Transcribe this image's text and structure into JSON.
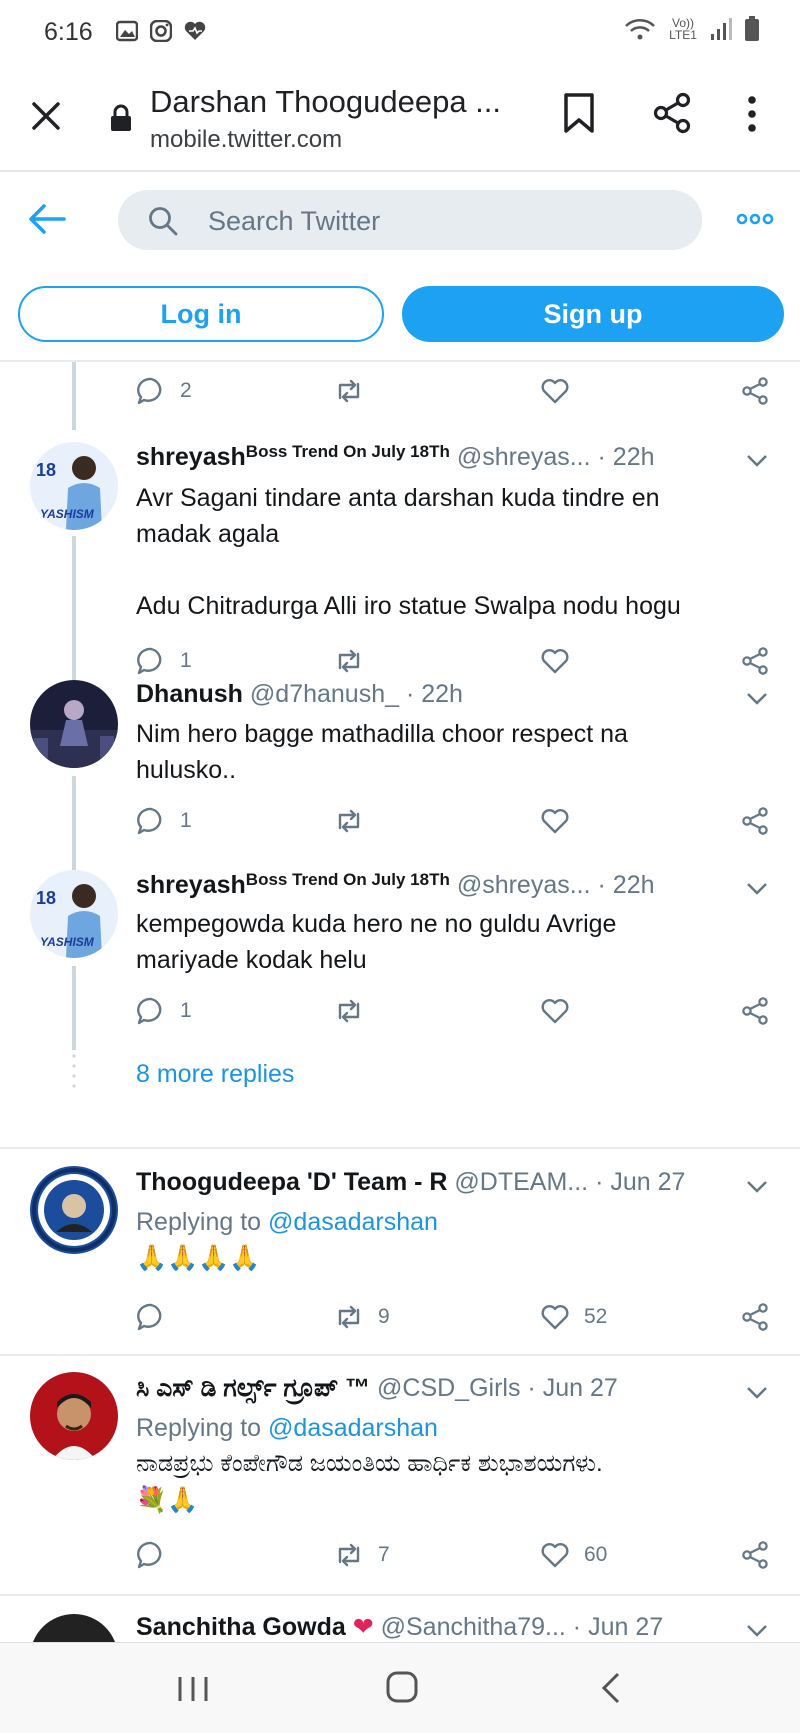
{
  "status_bar": {
    "time": "6:16",
    "network": "Vo)) LTE1"
  },
  "browser": {
    "title": "Darshan Thoogudeepa ...",
    "url": "mobile.twitter.com"
  },
  "twitter": {
    "search_placeholder": "Search Twitter",
    "login_label": "Log in",
    "signup_label": "Sign up",
    "accent": "#1da1f2"
  },
  "tweets": [
    {
      "replies": "2",
      "retweets": "",
      "likes": ""
    },
    {
      "name": "shreyash",
      "badge": "Boss Trend On July 18Th",
      "handle": "@shreyas...",
      "time": "· 22h",
      "lines": [
        "Avr Sagani tindare anta darshan kuda tindre en",
        "madak agala",
        "",
        "Adu Chitradurga Alli iro statue Swalpa nodu hogu"
      ],
      "replies": "1",
      "retweets": "",
      "likes": ""
    },
    {
      "name": "Dhanush",
      "handle": "@d7hanush_",
      "time": "· 22h",
      "lines": [
        "Nim hero bagge mathadilla choor respect na",
        "hulusko.."
      ],
      "replies": "1",
      "retweets": "",
      "likes": ""
    },
    {
      "name": "shreyash",
      "badge": "Boss Trend On July 18Th",
      "handle": "@shreyas...",
      "time": "· 22h",
      "lines": [
        "kempegowda kuda hero ne no guldu Avrige",
        "mariyade kodak helu"
      ],
      "replies": "1",
      "retweets": "",
      "likes": ""
    },
    {
      "more_replies": "8 more replies"
    },
    {
      "name": "Thoogudeepa 'D' Team - R",
      "handle": "@DTEAM...",
      "time": "· Jun 27",
      "replying_prefix": "Replying to",
      "replying_to": "@dasadarshan",
      "emoji": "🙏🙏🙏🙏",
      "replies": "",
      "retweets": "9",
      "likes": "52"
    },
    {
      "name": "ಸಿ ಎಸ್ ಡಿ ಗರ್ಲ್ಸ್ ಗ್ರೂಪ್ ™",
      "handle": "@CSD_Girls",
      "time": "· Jun 27",
      "replying_prefix": "Replying to",
      "replying_to": "@dasadarshan",
      "text": "ನಾಡಪ್ರಭು ಕೆಂಪೇಗೌಡ ಜಯಂತಿಯ ಹಾರ್ಧಿಕ ಶುಭಾಶಯಗಳು.",
      "emoji": "💐🙏",
      "replies": "",
      "retweets": "7",
      "likes": "60"
    },
    {
      "name": "Sanchitha Gowda",
      "handle": "@Sanchitha79...",
      "time": "· Jun 27"
    }
  ]
}
